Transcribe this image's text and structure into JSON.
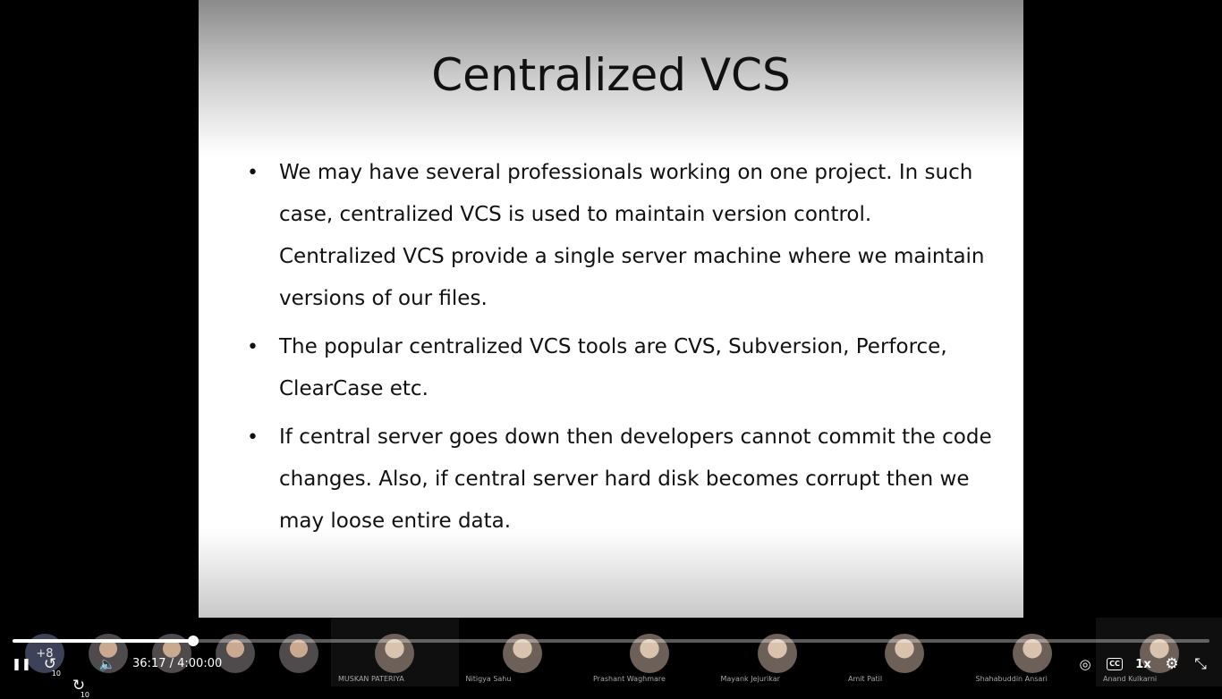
{
  "slide": {
    "title": "Centralized VCS",
    "bullets": [
      "We may have several professionals working on one project. In such case, centralized VCS is used to maintain version control. Centralized VCS provide a single server machine where we maintain versions of our files.",
      "The popular centralized VCS tools are CVS, Subversion, Perforce, ClearCase etc.",
      "If central server goes down then developers cannot commit the code changes. Also, if central server hard disk becomes corrupt then we may loose entire data."
    ],
    "bullet_symbol": "•"
  },
  "participants": {
    "more_count": "+8",
    "tiles": [
      {
        "name": "MUSKAN PATERIYA"
      },
      {
        "name": "Nitigya Sahu"
      },
      {
        "name": "Prashant Waghmare"
      },
      {
        "name": "Mayank Jejurikar"
      },
      {
        "name": "Amit Patil"
      },
      {
        "name": "Shahabuddin Ansari"
      },
      {
        "name": "Anand Kulkarni"
      }
    ]
  },
  "player": {
    "current_time": "36:17",
    "separator": " / ",
    "duration": "4:00:00",
    "progress_fraction": 0.1512,
    "skip_back_seconds": "10",
    "skip_forward_seconds": "10",
    "speed": "1x",
    "icons": {
      "pause": "pause-icon",
      "rewind": "rewind-10-icon",
      "forward": "forward-10-icon",
      "volume": "volume-icon",
      "audio_description": "audio-description-icon",
      "captions": "captions-icon",
      "settings": "gear-icon",
      "exit_fullscreen": "exit-fullscreen-icon"
    },
    "glyphs": {
      "pause": "❚❚",
      "rewind": "↺",
      "forward": "↻",
      "volume": "🔈",
      "audio_description": "◎",
      "captions": "CC",
      "settings": "⚙",
      "exit_fullscreen": "⤡"
    }
  }
}
